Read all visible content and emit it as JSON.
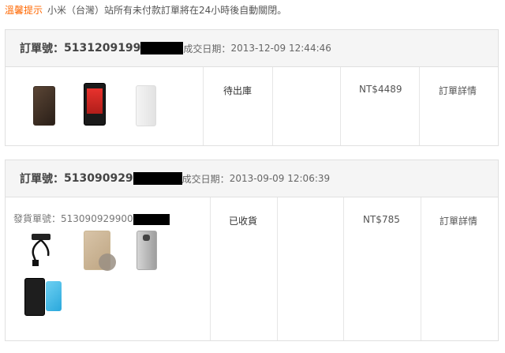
{
  "notice": {
    "label": "溫馨提示",
    "text": "小米（台灣）站所有未付款訂單將在24小時後自動關閉。"
  },
  "orders": [
    {
      "number_label": "訂單號：",
      "number": "5131209199",
      "date_label": "成交日期：",
      "date": "2013-12-09 12:44:46",
      "status": "待出庫",
      "price": "NT$4489",
      "detail": "訂單詳情",
      "items": [
        "brown-phone-case",
        "red-smartphone",
        "white-phone-case"
      ]
    },
    {
      "number_label": "訂單號：",
      "number": "513090929",
      "date_label": "成交日期：",
      "date": "2013-09-09 12:06:39",
      "shipment_label": "發貨單號：",
      "shipment_number": "513090929900",
      "status": "已收貨",
      "price": "NT$785",
      "detail": "訂單詳情",
      "items": [
        "otg-cable",
        "screen-protector",
        "clear-phone-case",
        "black-power-bank",
        "blue-power-bank"
      ]
    }
  ]
}
